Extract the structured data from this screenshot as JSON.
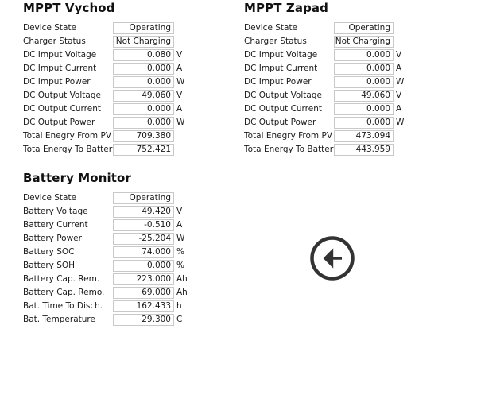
{
  "page": {
    "background_color": "#ffffff",
    "text_color": "#1a1a1a",
    "field_border_color": "#c9c9c9"
  },
  "panels": {
    "mppt_vychod": {
      "title": "MPPT Vychod",
      "rows": [
        {
          "label": "Device State",
          "value": "Operating",
          "unit": ""
        },
        {
          "label": "Charger Status",
          "value": "Not Charging",
          "unit": ""
        },
        {
          "label": "DC Imput Voltage",
          "value": "0.080",
          "unit": "V"
        },
        {
          "label": "DC Imput Current",
          "value": "0.000",
          "unit": "A"
        },
        {
          "label": "DC Imput Power",
          "value": "0.000",
          "unit": "W"
        },
        {
          "label": "DC Output Voltage",
          "value": "49.060",
          "unit": "V"
        },
        {
          "label": "DC Output Current",
          "value": "0.000",
          "unit": "A"
        },
        {
          "label": "DC Output Power",
          "value": "0.000",
          "unit": "W"
        },
        {
          "label": "Total Enegry From PV",
          "value": "709.380",
          "unit": ""
        },
        {
          "label": "Tota Energy To Battery",
          "value": "752.421",
          "unit": ""
        }
      ]
    },
    "mppt_zapad": {
      "title": "MPPT Zapad",
      "rows": [
        {
          "label": "Device State",
          "value": "Operating",
          "unit": ""
        },
        {
          "label": "Charger Status",
          "value": "Not Charging",
          "unit": ""
        },
        {
          "label": "DC Imput Voltage",
          "value": "0.000",
          "unit": "V"
        },
        {
          "label": "DC Imput Current",
          "value": "0.000",
          "unit": "A"
        },
        {
          "label": "DC Imput Power",
          "value": "0.000",
          "unit": "W"
        },
        {
          "label": "DC Output Voltage",
          "value": "49.060",
          "unit": "V"
        },
        {
          "label": "DC Output Current",
          "value": "0.000",
          "unit": "A"
        },
        {
          "label": "DC Output Power",
          "value": "0.000",
          "unit": "W"
        },
        {
          "label": "Total Enegry From PV",
          "value": "473.094",
          "unit": ""
        },
        {
          "label": "Tota Energy To Battery",
          "value": "443.959",
          "unit": ""
        }
      ]
    },
    "battery_monitor": {
      "title": "Battery Monitor",
      "rows": [
        {
          "label": "Device State",
          "value": "Operating",
          "unit": ""
        },
        {
          "label": "Battery Voltage",
          "value": "49.420",
          "unit": "V"
        },
        {
          "label": "Battery Current",
          "value": "-0.510",
          "unit": "A"
        },
        {
          "label": "Battery Power",
          "value": "-25.204",
          "unit": "W"
        },
        {
          "label": "Battery SOC",
          "value": "74.000",
          "unit": "%"
        },
        {
          "label": "Battery SOH",
          "value": "0.000",
          "unit": "%"
        },
        {
          "label": "Battery Cap. Rem.",
          "value": "223.000",
          "unit": "Ah"
        },
        {
          "label": "Battery Cap. Remo.",
          "value": "69.000",
          "unit": "Ah"
        },
        {
          "label": "Bat. Time To Disch.",
          "value": "162.433",
          "unit": "h"
        },
        {
          "label": "Bat. Temperature",
          "value": "29.300",
          "unit": "C"
        }
      ]
    }
  },
  "back_button": {
    "icon": "arrow-left-circle-icon",
    "color": "#333333",
    "label": ""
  }
}
